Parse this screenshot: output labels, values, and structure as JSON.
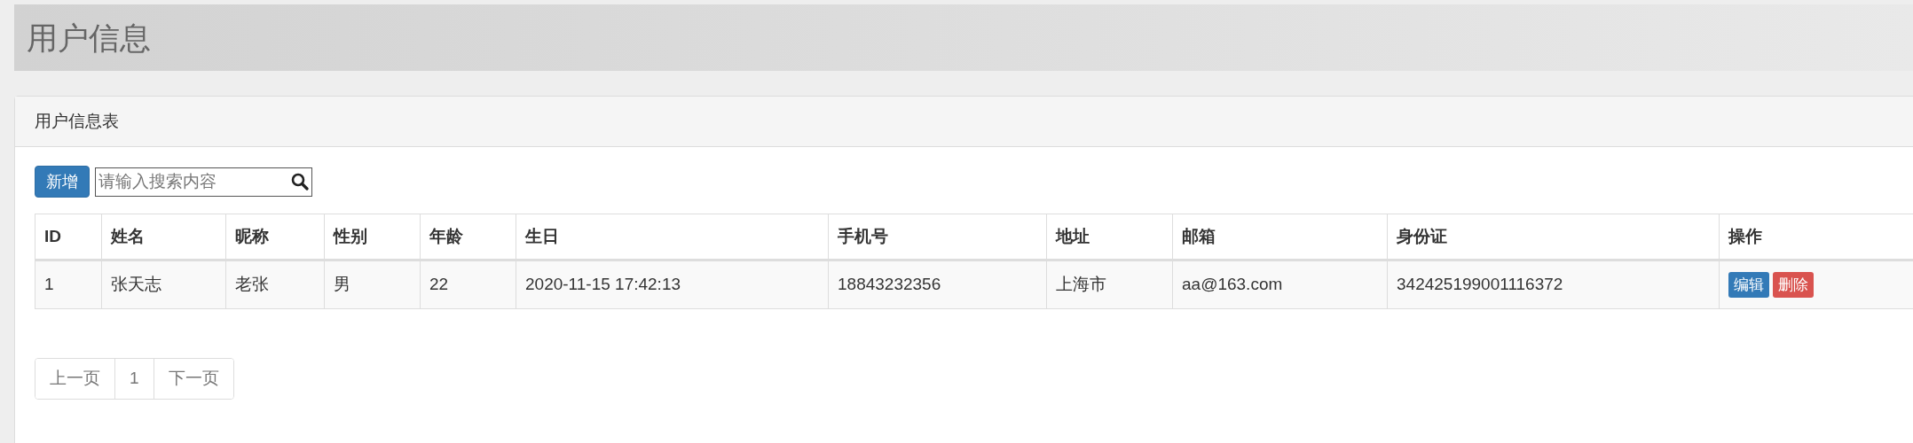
{
  "page_title": "用户信息",
  "panel": {
    "title": "用户信息表",
    "add_button": "新增",
    "search": {
      "placeholder": "请输入搜索内容"
    },
    "table": {
      "columns": [
        "ID",
        "姓名",
        "昵称",
        "性别",
        "年龄",
        "生日",
        "手机号",
        "地址",
        "邮箱",
        "身份证",
        "操作"
      ],
      "rows": [
        {
          "cells": [
            "1",
            "张天志",
            "老张",
            "男",
            "22",
            "2020-11-15 17:42:13",
            "18843232356",
            "上海市",
            "aa@163.com",
            "342425199001116372"
          ],
          "actions": [
            {
              "label": "编辑",
              "kind": "edit"
            },
            {
              "label": "删除",
              "kind": "delete"
            }
          ]
        }
      ]
    },
    "pagination": [
      "上一页",
      "1",
      "下一页"
    ]
  }
}
